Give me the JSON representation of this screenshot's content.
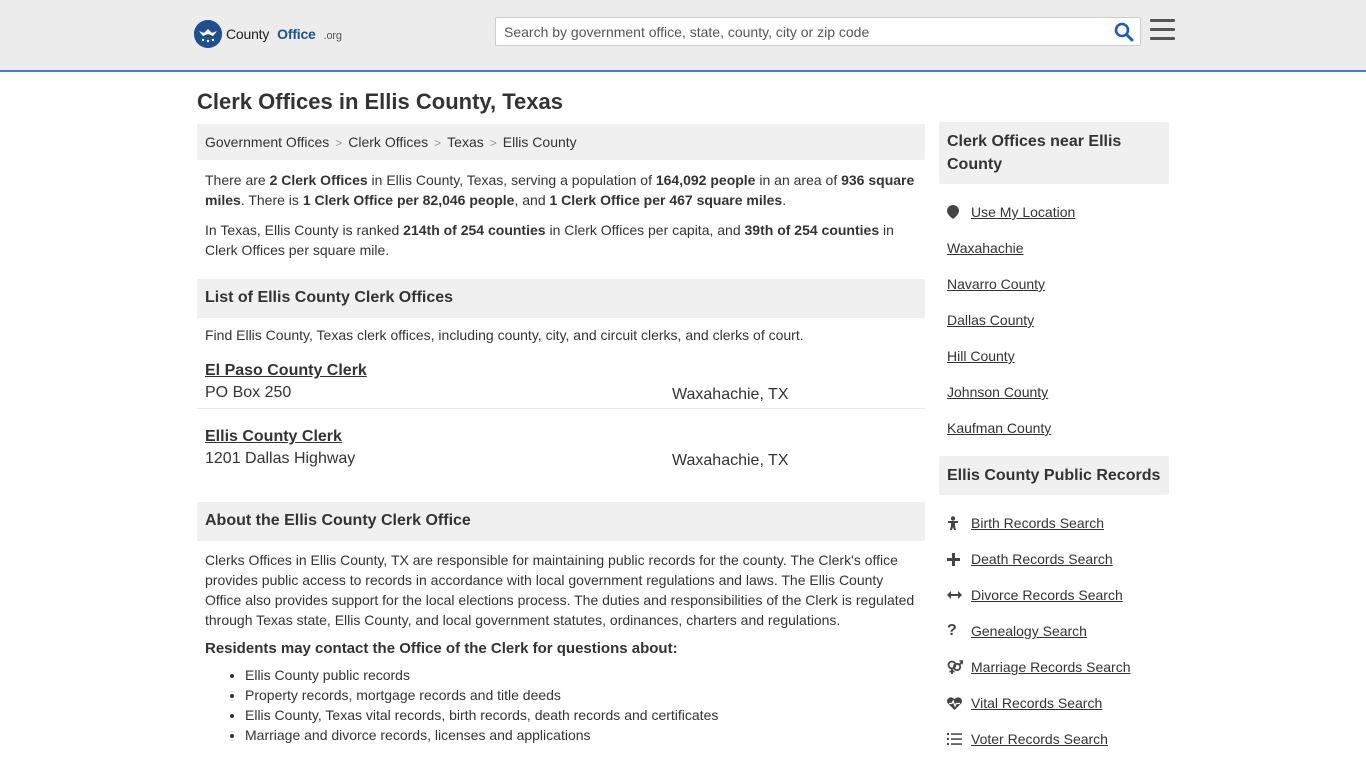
{
  "header": {
    "logo_text_county": "County",
    "logo_text_office": "Office",
    "logo_text_org": ".org",
    "search_placeholder": "Search by government office, state, county, city or zip code"
  },
  "page": {
    "title": "Clerk Offices in Ellis County, Texas"
  },
  "breadcrumb": [
    "Government Offices",
    "Clerk Offices",
    "Texas",
    "Ellis County"
  ],
  "intro": {
    "p1": {
      "a": "There are ",
      "b": "2 Clerk Offices",
      "c": " in Ellis County, Texas, serving a population of ",
      "d": "164,092 people",
      "e": " in an area of ",
      "f": "936 square miles",
      "g": ". There is ",
      "h": "1 Clerk Office per 82,046 people",
      "i": ", and ",
      "j": "1 Clerk Office per 467 square miles",
      "k": "."
    },
    "p2": {
      "a": "In Texas, Ellis County is ranked ",
      "b": "214th of 254 counties",
      "c": " in Clerk Offices per capita, and ",
      "d": "39th of 254 counties",
      "e": " in Clerk Offices per square mile."
    }
  },
  "list": {
    "heading": "List of Ellis County Clerk Offices",
    "description": "Find Ellis County, Texas clerk offices, including county, city, and circuit clerks, and clerks of court.",
    "offices": [
      {
        "name": "El Paso County Clerk",
        "address": "PO Box 250",
        "city": "Waxahachie, TX"
      },
      {
        "name": "Ellis County Clerk",
        "address": "1201 Dallas Highway",
        "city": "Waxahachie, TX"
      }
    ]
  },
  "about": {
    "heading": "About the Ellis County Clerk Office",
    "text": "Clerks Offices in Ellis County, TX are responsible for maintaining public records for the county. The Clerk's office provides public access to records in accordance with local government regulations and laws. The Ellis County Office also provides support for the local elections process. The duties and responsibilities of the Clerk is regulated through Texas state, Ellis County, and local government statutes, ordinances, charters and regulations.",
    "contact_heading": "Residents may contact the Office of the Clerk for questions about:",
    "contact_items": [
      "Ellis County public records",
      "Property records, mortgage records and title deeds",
      "Ellis County, Texas vital records, birth records, death records and certificates",
      "Marriage and divorce records, licenses and applications"
    ]
  },
  "sidebar": {
    "near_heading": "Clerk Offices near Ellis County",
    "near_items": [
      {
        "label": "Use My Location",
        "icon": "location-pin-icon"
      },
      {
        "label": "Waxahachie"
      },
      {
        "label": "Navarro County"
      },
      {
        "label": "Dallas County"
      },
      {
        "label": "Hill County"
      },
      {
        "label": "Johnson County"
      },
      {
        "label": "Kaufman County"
      }
    ],
    "records_heading": "Ellis County Public Records",
    "records_items": [
      {
        "label": "Birth Records Search",
        "icon": "baby-icon"
      },
      {
        "label": "Death Records Search",
        "icon": "cross-icon"
      },
      {
        "label": "Divorce Records Search",
        "icon": "arrows-horizontal-icon"
      },
      {
        "label": "Genealogy Search",
        "icon": "question-icon"
      },
      {
        "label": "Marriage Records Search",
        "icon": "gender-icon"
      },
      {
        "label": "Vital Records Search",
        "icon": "heartbeat-icon"
      },
      {
        "label": "Voter Records Search",
        "icon": "list-icon"
      }
    ]
  },
  "colors": {
    "brand": "#1f4f8f",
    "header_border": "#3d7fd1",
    "search_icon": "#1a5fb4"
  }
}
